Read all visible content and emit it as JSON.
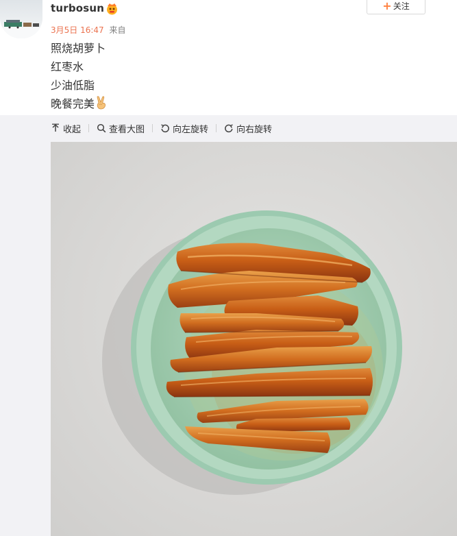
{
  "user": {
    "name": "turbosun",
    "badge_icon": "vip-badge-icon"
  },
  "meta": {
    "time": "3月5日 16:47",
    "source_prefix": "来自"
  },
  "follow": {
    "icon": "plus-icon",
    "label": "关注"
  },
  "post": {
    "lines": [
      "照烧胡萝卜",
      "红枣水",
      "少油低脂",
      "晚餐完美"
    ],
    "emoji": "victory-hand-emoji"
  },
  "toolbar": {
    "collapse_label": "收起",
    "view_large_label": "查看大图",
    "rotate_left_label": "向左旋转",
    "rotate_right_label": "向右旋转"
  },
  "colors": {
    "accent_orange": "#eb7350",
    "follow_plus": "#ff8140",
    "text_main": "#333333",
    "text_meta": "#808080",
    "band_gray": "#f2f2f5",
    "counter_gray": "#d9d9d8",
    "bowl_green": "#a8cfb6",
    "carrot_orange": "#c95b16"
  }
}
